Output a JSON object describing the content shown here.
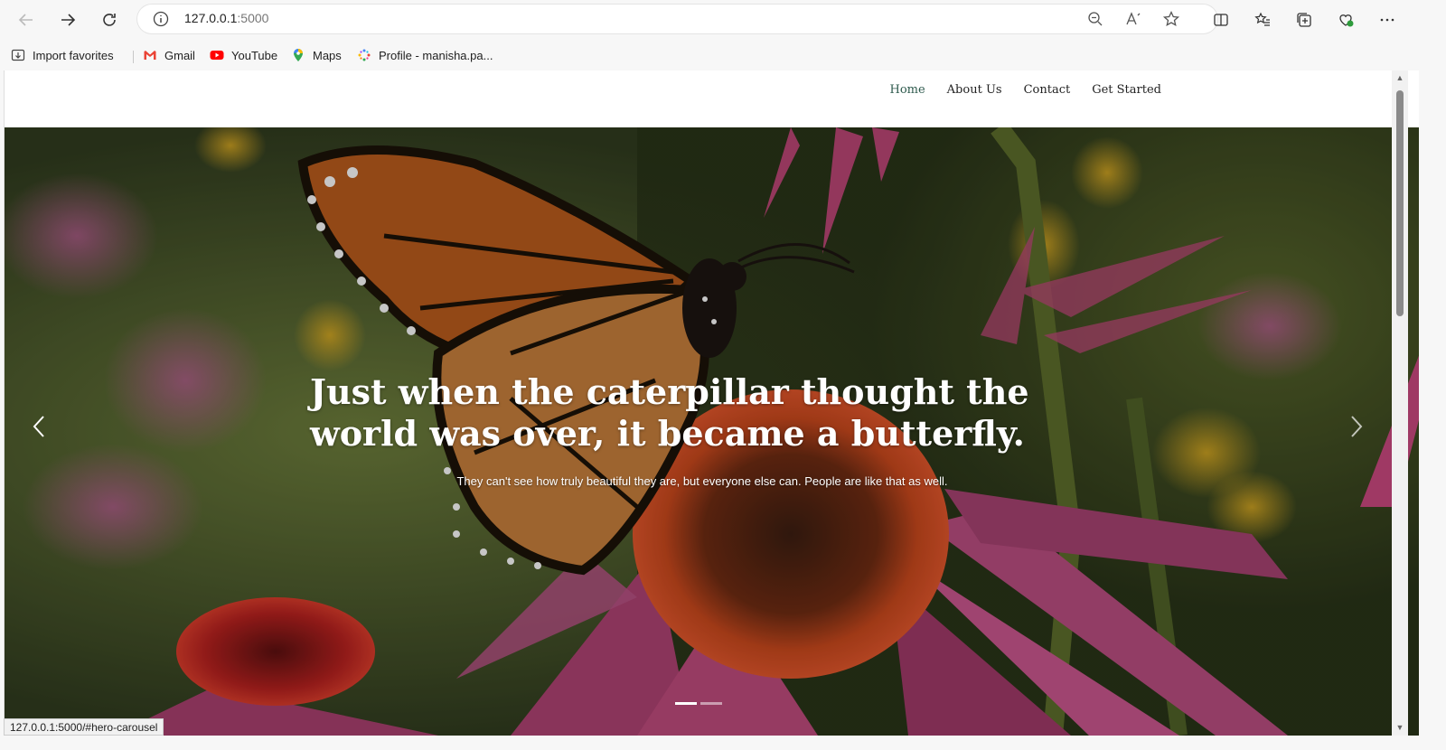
{
  "browser": {
    "url_host": "127.0.0.1",
    "url_port": ":5000",
    "status_url": "127.0.0.1:5000/#hero-carousel"
  },
  "favorites": [
    {
      "label": "Import favorites",
      "icon": "import-icon"
    },
    {
      "label": "Gmail",
      "icon": "gmail-icon"
    },
    {
      "label": "YouTube",
      "icon": "youtube-icon"
    },
    {
      "label": "Maps",
      "icon": "maps-icon"
    },
    {
      "label": "Profile - manisha.pa...",
      "icon": "profile-icon"
    }
  ],
  "nav": {
    "items": [
      "Home",
      "About Us",
      "Contact",
      "Get Started"
    ],
    "active": "Home",
    "active_color": "#2f5b4e"
  },
  "hero": {
    "title": "Just when the caterpillar thought the world was over, it became a butterfly.",
    "subtitle": "They can't see how truly beautiful they are, but everyone else can. People are like that as well.",
    "slides": 2,
    "active_slide": 1
  }
}
